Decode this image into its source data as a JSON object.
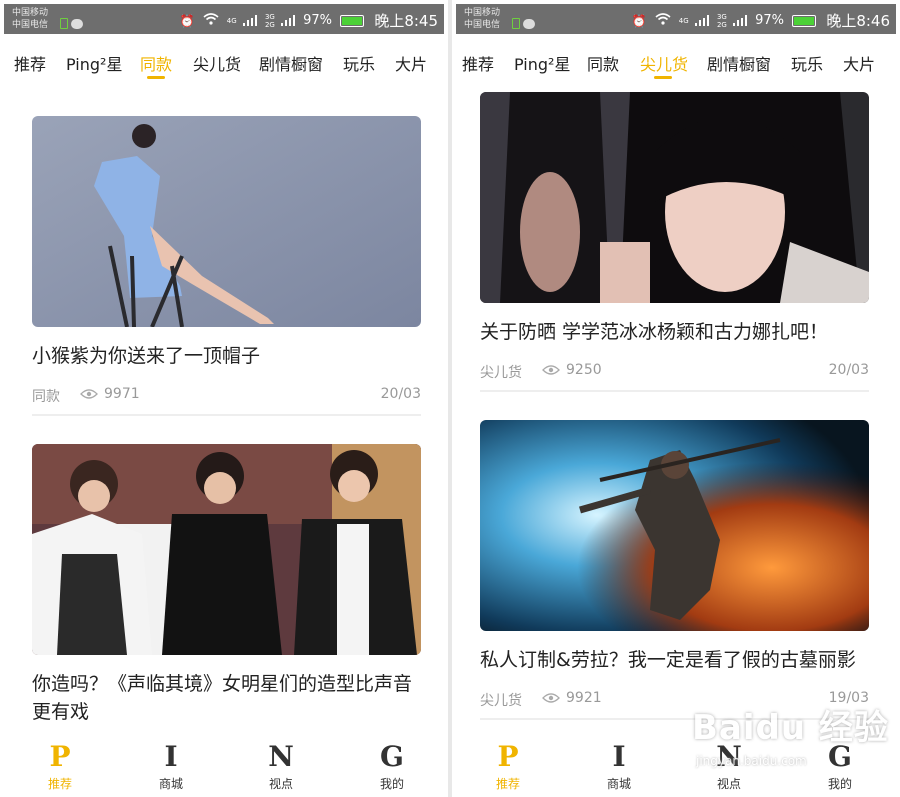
{
  "status_left": {
    "carrier1": "中国移动",
    "carrier2": "中国电信",
    "net": "4G",
    "net2": "3G",
    "net3": "2G",
    "battery": "97%",
    "time": "晚上8:45"
  },
  "status_right": {
    "carrier1": "中国移动",
    "carrier2": "中国电信",
    "net": "4G",
    "net2": "3G",
    "net3": "2G",
    "battery": "97%",
    "time": "晚上8:46"
  },
  "tabs": [
    "推荐",
    "Ping²星",
    "同款",
    "尖儿货",
    "剧情橱窗",
    "玩乐",
    "大片"
  ],
  "left_active_tab": "同款",
  "right_active_tab": "尖儿货",
  "left_feed": [
    {
      "title": "小猴紫为你送来了一顶帽子",
      "tag": "同款",
      "views": "9971",
      "date": "20/03"
    },
    {
      "title": "你造吗？《声临其境》女明星们的造型比声音更有戏"
    }
  ],
  "right_feed": [
    {
      "title": "关于防晒 学学范冰冰杨颖和古力娜扎吧！",
      "tag": "尖儿货",
      "views": "9250",
      "date": "20/03"
    },
    {
      "title": "私人订制&劳拉？我一定是看了假的古墓丽影",
      "tag": "尖儿货",
      "views": "9921",
      "date": "19/03"
    }
  ],
  "bottom_nav": [
    {
      "glyph": "P",
      "label": "推荐"
    },
    {
      "glyph": "I",
      "label": "商城"
    },
    {
      "glyph": "N",
      "label": "视点"
    },
    {
      "glyph": "G",
      "label": "我的"
    }
  ],
  "watermark": {
    "logo": "Baidu 经验",
    "url": "jingyan.baidu.com"
  },
  "colors": {
    "accent": "#f0b400",
    "statusbar": "#6e6e6e",
    "meta": "#999999",
    "battery": "#4cd137"
  },
  "icons": [
    "alarm-icon",
    "wifi-icon",
    "signal-icon",
    "battery-icon",
    "message-icon",
    "sim-icon",
    "eye-icon"
  ]
}
